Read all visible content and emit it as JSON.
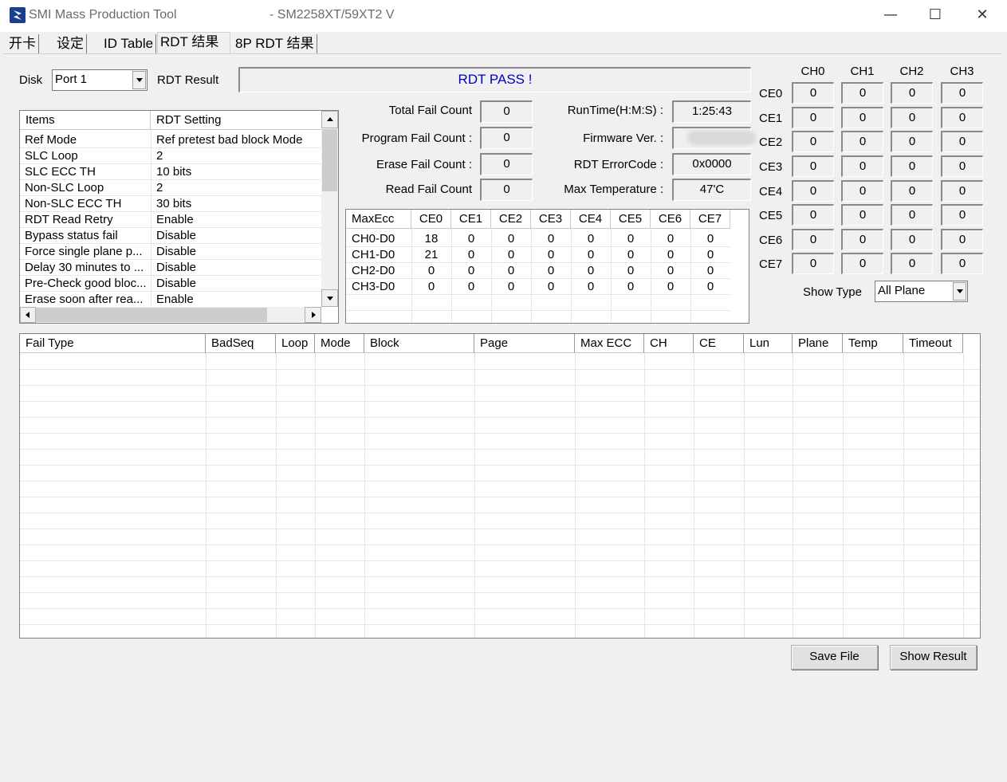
{
  "window": {
    "app_title": "SMI Mass Production Tool",
    "version_title": "- SM2258XT/59XT2   V",
    "minimize_glyph": "—",
    "maximize_glyph": "☐",
    "close_glyph": "✕"
  },
  "tabs": [
    {
      "label": "开卡"
    },
    {
      "label": "设定"
    },
    {
      "label": "ID Table"
    },
    {
      "label": "RDT 结果",
      "active": true
    },
    {
      "label": "8P RDT 结果"
    }
  ],
  "disk": {
    "label": "Disk",
    "value": "Port 1"
  },
  "rdt_result": {
    "label": "RDT Result",
    "value": "RDT PASS !",
    "color": "#0000c0"
  },
  "settings_list": {
    "headers": [
      "Items",
      "RDT Setting"
    ],
    "rows": [
      [
        "Ref Mode",
        "Ref pretest bad block Mode"
      ],
      [
        "SLC Loop",
        "2"
      ],
      [
        "SLC ECC TH",
        "10 bits"
      ],
      [
        "Non-SLC Loop",
        "2"
      ],
      [
        "Non-SLC ECC TH",
        "30 bits"
      ],
      [
        "RDT Read Retry",
        "Enable"
      ],
      [
        "Bypass status fail",
        "Disable"
      ],
      [
        "Force single plane p...",
        "Disable"
      ],
      [
        "Delay 30 minutes to ...",
        "Disable"
      ],
      [
        "Pre-Check good bloc...",
        "Disable"
      ],
      [
        "Erase soon after rea...",
        "Enable"
      ]
    ]
  },
  "counts": {
    "total_fail": {
      "label": "Total Fail Count",
      "value": "0"
    },
    "program_fail": {
      "label": "Program Fail Count :",
      "value": "0"
    },
    "erase_fail": {
      "label": "Erase Fail Count :",
      "value": "0"
    },
    "read_fail": {
      "label": "Read Fail Count",
      "value": "0"
    }
  },
  "info": {
    "runtime": {
      "label": "RunTime(H:M:S) :",
      "value": "1:25:43"
    },
    "firmware": {
      "label": "Firmware Ver. :",
      "value": ""
    },
    "error_code": {
      "label": "RDT ErrorCode :",
      "value": "0x0000"
    },
    "max_temp": {
      "label": "Max Temperature :",
      "value": "47'C"
    }
  },
  "maxecc": {
    "headers": [
      "MaxEcc",
      "CE0",
      "CE1",
      "CE2",
      "CE3",
      "CE4",
      "CE5",
      "CE6",
      "CE7"
    ],
    "rows": [
      [
        "CH0-D0",
        "18",
        "0",
        "0",
        "0",
        "0",
        "0",
        "0",
        "0"
      ],
      [
        "CH1-D0",
        "21",
        "0",
        "0",
        "0",
        "0",
        "0",
        "0",
        "0"
      ],
      [
        "CH2-D0",
        "0",
        "0",
        "0",
        "0",
        "0",
        "0",
        "0",
        "0"
      ],
      [
        "CH3-D0",
        "0",
        "0",
        "0",
        "0",
        "0",
        "0",
        "0",
        "0"
      ]
    ]
  },
  "ce_grid": {
    "channels": [
      "CH0",
      "CH1",
      "CH2",
      "CH3"
    ],
    "ces": [
      "CE0",
      "CE1",
      "CE2",
      "CE3",
      "CE4",
      "CE5",
      "CE6",
      "CE7"
    ],
    "values": [
      [
        "0",
        "0",
        "0",
        "0"
      ],
      [
        "0",
        "0",
        "0",
        "0"
      ],
      [
        "0",
        "0",
        "0",
        "0"
      ],
      [
        "0",
        "0",
        "0",
        "0"
      ],
      [
        "0",
        "0",
        "0",
        "0"
      ],
      [
        "0",
        "0",
        "0",
        "0"
      ],
      [
        "0",
        "0",
        "0",
        "0"
      ],
      [
        "0",
        "0",
        "0",
        "0"
      ]
    ]
  },
  "show_type": {
    "label": "Show Type",
    "value": "All Plane"
  },
  "fail_table": {
    "headers": [
      "Fail Type",
      "BadSeq",
      "Loop",
      "Mode",
      "Block",
      "Page",
      "Max ECC",
      "CH",
      "CE",
      "Lun",
      "Plane",
      "Temp",
      "Timeout"
    ],
    "rows": []
  },
  "buttons": {
    "save_file": "Save File",
    "show_result": "Show Result"
  }
}
